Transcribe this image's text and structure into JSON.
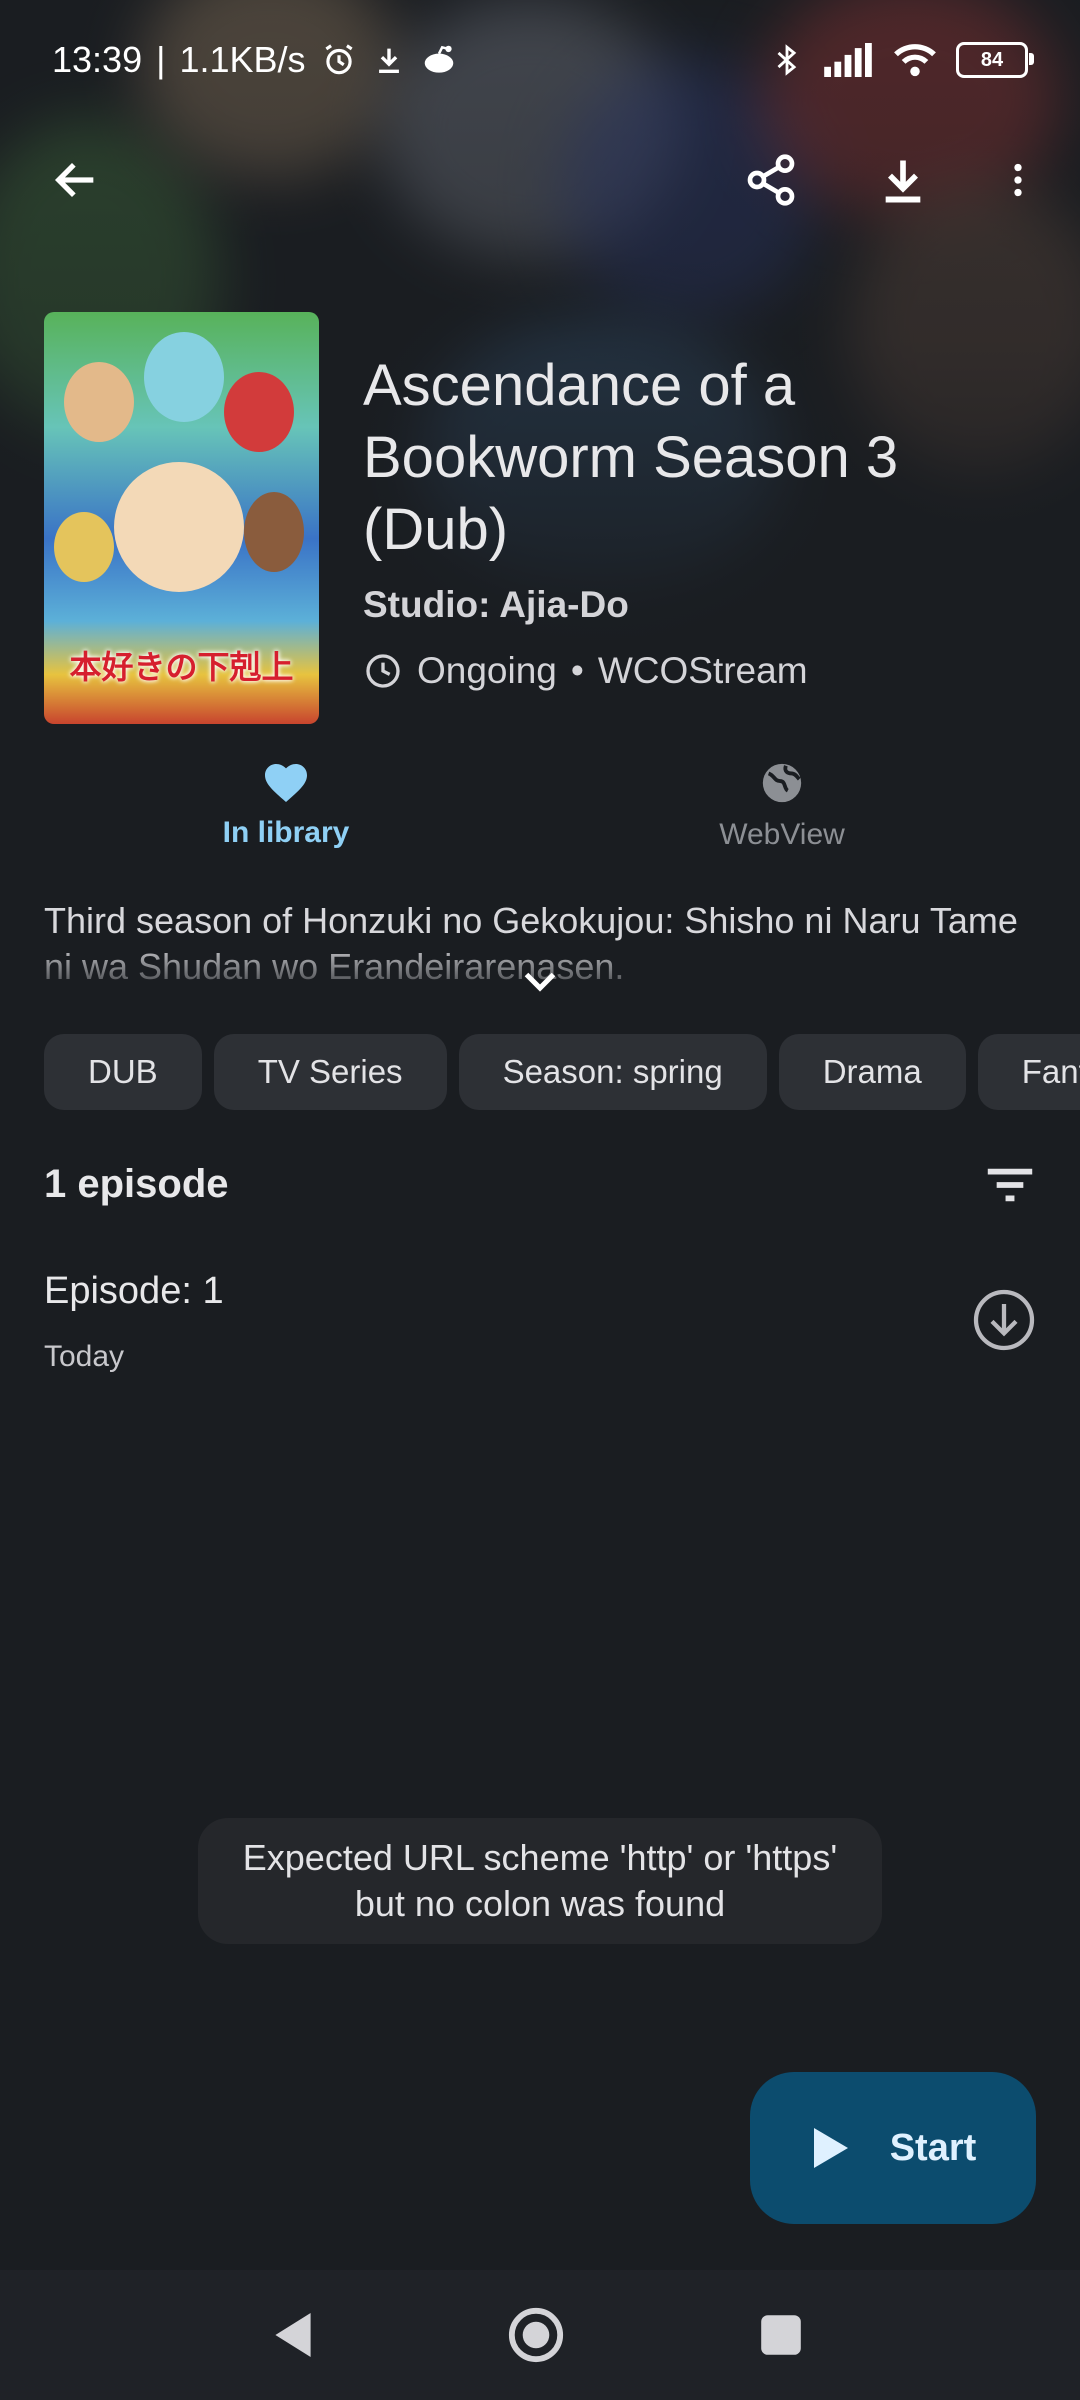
{
  "status_bar": {
    "time": "13:39",
    "separator": "|",
    "net_speed": "1.1KB/s",
    "battery": "84",
    "icons": [
      "alarm-icon",
      "download-icon",
      "reddit-icon",
      "bluetooth-icon",
      "signal-icon",
      "wifi-icon",
      "battery-icon"
    ]
  },
  "toolbar": {
    "icons": [
      "back-arrow-icon",
      "share-icon",
      "download-icon",
      "more-vert-icon"
    ]
  },
  "anime": {
    "title": "Ascendance of a Bookworm Season 3 (Dub)",
    "studio": "Studio: Ajia-Do",
    "status": "Ongoing",
    "bullet": "•",
    "source": "WCOStream",
    "cover_text": "本好きの下剋上"
  },
  "actions": {
    "library_label": "In library",
    "webview_label": "WebView"
  },
  "description": "Third season of Honzuki no Gekokujou: Shisho ni Naru Tame ni wa Shudan wo Erandeirarenasen.",
  "genres": [
    "DUB",
    "TV Series",
    "Season: spring",
    "Drama",
    "Fantasy"
  ],
  "episodes": {
    "header": "1 episode",
    "items": [
      {
        "title": "Episode: 1",
        "date": "Today"
      }
    ]
  },
  "toast": "Expected URL scheme 'http' or 'https' but no colon was found",
  "fab": {
    "label": "Start"
  },
  "colors": {
    "background": "#1a1d21",
    "accent": "#8fd0f5",
    "chip": "#2d3035",
    "fab": "#0c4c6e"
  }
}
